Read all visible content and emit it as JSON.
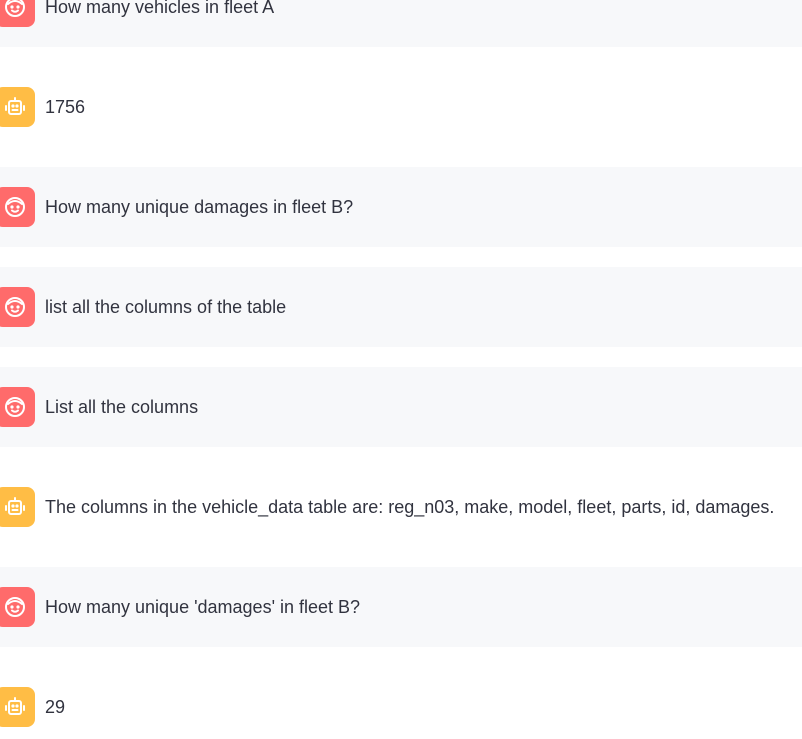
{
  "messages": [
    {
      "role": "user",
      "text": "How many vehicles in fleet A"
    },
    {
      "role": "assistant",
      "text": "1756"
    },
    {
      "role": "user",
      "text": "How many unique damages in fleet B?"
    },
    {
      "role": "user",
      "text": "list all the columns of the table"
    },
    {
      "role": "user",
      "text": "List all the columns"
    },
    {
      "role": "assistant",
      "text": "The columns in the vehicle_data table are: reg_n03, make, model, fleet, parts, id, damages."
    },
    {
      "role": "user",
      "text": "How many unique 'damages' in fleet B?"
    },
    {
      "role": "assistant",
      "text": "29"
    }
  ],
  "colors": {
    "user_avatar": "#ff6b6b",
    "assistant_avatar": "#ffbd45",
    "user_bg": "#f7f8fa",
    "text": "#31333f"
  },
  "icons": {
    "user": "smiling-face-icon",
    "assistant": "robot-face-icon"
  }
}
